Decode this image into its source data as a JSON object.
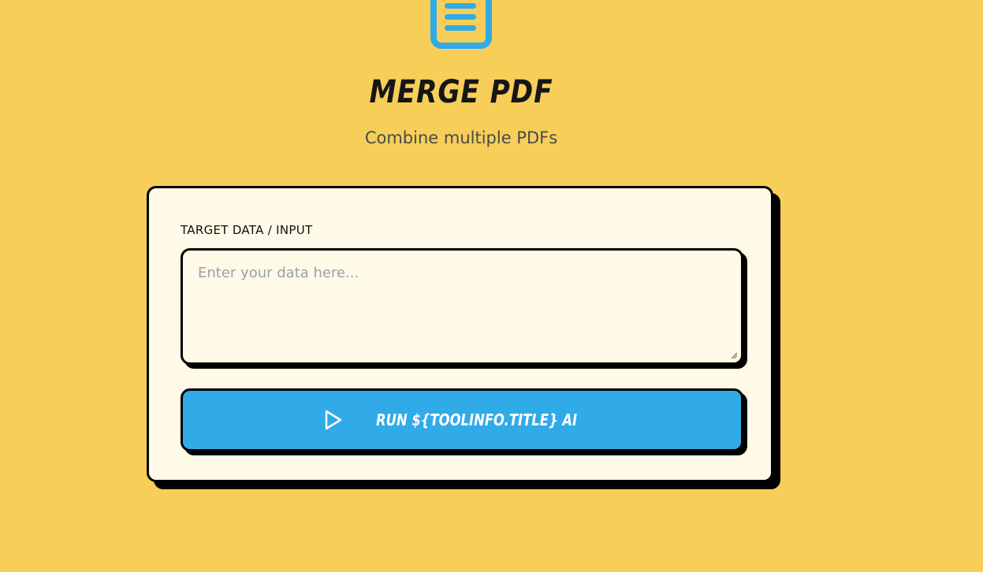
{
  "header": {
    "icon": "document-icon",
    "title": "MERGE PDF",
    "subtitle": "Combine multiple PDFs"
  },
  "form": {
    "field_label": "TARGET DATA / INPUT",
    "input_placeholder": "Enter your data here...",
    "input_value": "",
    "run_button_label": "RUN ${TOOLINFO.TITLE} AI",
    "run_button_icon": "play-icon"
  },
  "colors": {
    "background": "#f6ce58",
    "card": "#fff9e7",
    "accent": "#31aae8",
    "border": "#000000"
  }
}
